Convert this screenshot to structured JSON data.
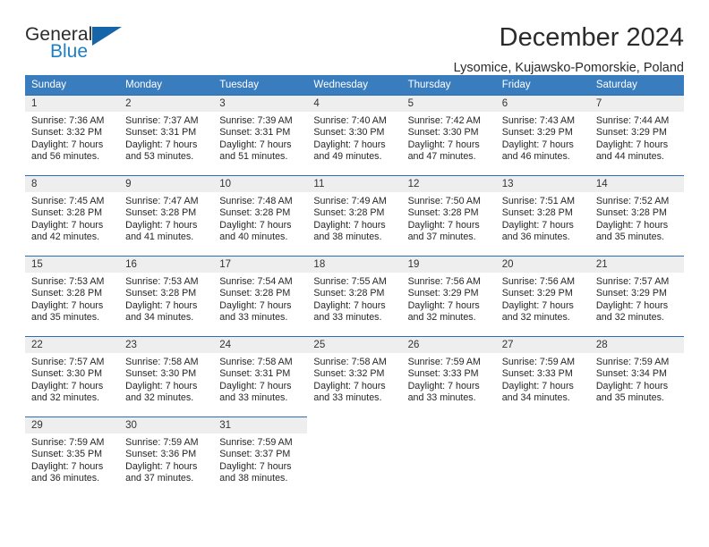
{
  "brand": {
    "name_top": "General",
    "name_bottom": "Blue",
    "mark": "triangle-logo",
    "color_top": "#2b2b2b",
    "color_bottom": "#1f7fc4",
    "color_mark": "#1565a8"
  },
  "header": {
    "title": "December 2024",
    "subtitle": "Lysomice, Kujawsko-Pomorskie, Poland"
  },
  "colors": {
    "header_bg": "#3a7dbf",
    "row_rule": "#2a6fb3",
    "daynum_bg": "#eeeeee",
    "text": "#262626"
  },
  "calendar": {
    "weekday_headers": [
      "Sunday",
      "Monday",
      "Tuesday",
      "Wednesday",
      "Thursday",
      "Friday",
      "Saturday"
    ],
    "weeks": [
      [
        {
          "day": "1",
          "sunrise": "Sunrise: 7:36 AM",
          "sunset": "Sunset: 3:32 PM",
          "daylight_line1": "Daylight: 7 hours",
          "daylight_line2": "and 56 minutes."
        },
        {
          "day": "2",
          "sunrise": "Sunrise: 7:37 AM",
          "sunset": "Sunset: 3:31 PM",
          "daylight_line1": "Daylight: 7 hours",
          "daylight_line2": "and 53 minutes."
        },
        {
          "day": "3",
          "sunrise": "Sunrise: 7:39 AM",
          "sunset": "Sunset: 3:31 PM",
          "daylight_line1": "Daylight: 7 hours",
          "daylight_line2": "and 51 minutes."
        },
        {
          "day": "4",
          "sunrise": "Sunrise: 7:40 AM",
          "sunset": "Sunset: 3:30 PM",
          "daylight_line1": "Daylight: 7 hours",
          "daylight_line2": "and 49 minutes."
        },
        {
          "day": "5",
          "sunrise": "Sunrise: 7:42 AM",
          "sunset": "Sunset: 3:30 PM",
          "daylight_line1": "Daylight: 7 hours",
          "daylight_line2": "and 47 minutes."
        },
        {
          "day": "6",
          "sunrise": "Sunrise: 7:43 AM",
          "sunset": "Sunset: 3:29 PM",
          "daylight_line1": "Daylight: 7 hours",
          "daylight_line2": "and 46 minutes."
        },
        {
          "day": "7",
          "sunrise": "Sunrise: 7:44 AM",
          "sunset": "Sunset: 3:29 PM",
          "daylight_line1": "Daylight: 7 hours",
          "daylight_line2": "and 44 minutes."
        }
      ],
      [
        {
          "day": "8",
          "sunrise": "Sunrise: 7:45 AM",
          "sunset": "Sunset: 3:28 PM",
          "daylight_line1": "Daylight: 7 hours",
          "daylight_line2": "and 42 minutes."
        },
        {
          "day": "9",
          "sunrise": "Sunrise: 7:47 AM",
          "sunset": "Sunset: 3:28 PM",
          "daylight_line1": "Daylight: 7 hours",
          "daylight_line2": "and 41 minutes."
        },
        {
          "day": "10",
          "sunrise": "Sunrise: 7:48 AM",
          "sunset": "Sunset: 3:28 PM",
          "daylight_line1": "Daylight: 7 hours",
          "daylight_line2": "and 40 minutes."
        },
        {
          "day": "11",
          "sunrise": "Sunrise: 7:49 AM",
          "sunset": "Sunset: 3:28 PM",
          "daylight_line1": "Daylight: 7 hours",
          "daylight_line2": "and 38 minutes."
        },
        {
          "day": "12",
          "sunrise": "Sunrise: 7:50 AM",
          "sunset": "Sunset: 3:28 PM",
          "daylight_line1": "Daylight: 7 hours",
          "daylight_line2": "and 37 minutes."
        },
        {
          "day": "13",
          "sunrise": "Sunrise: 7:51 AM",
          "sunset": "Sunset: 3:28 PM",
          "daylight_line1": "Daylight: 7 hours",
          "daylight_line2": "and 36 minutes."
        },
        {
          "day": "14",
          "sunrise": "Sunrise: 7:52 AM",
          "sunset": "Sunset: 3:28 PM",
          "daylight_line1": "Daylight: 7 hours",
          "daylight_line2": "and 35 minutes."
        }
      ],
      [
        {
          "day": "15",
          "sunrise": "Sunrise: 7:53 AM",
          "sunset": "Sunset: 3:28 PM",
          "daylight_line1": "Daylight: 7 hours",
          "daylight_line2": "and 35 minutes."
        },
        {
          "day": "16",
          "sunrise": "Sunrise: 7:53 AM",
          "sunset": "Sunset: 3:28 PM",
          "daylight_line1": "Daylight: 7 hours",
          "daylight_line2": "and 34 minutes."
        },
        {
          "day": "17",
          "sunrise": "Sunrise: 7:54 AM",
          "sunset": "Sunset: 3:28 PM",
          "daylight_line1": "Daylight: 7 hours",
          "daylight_line2": "and 33 minutes."
        },
        {
          "day": "18",
          "sunrise": "Sunrise: 7:55 AM",
          "sunset": "Sunset: 3:28 PM",
          "daylight_line1": "Daylight: 7 hours",
          "daylight_line2": "and 33 minutes."
        },
        {
          "day": "19",
          "sunrise": "Sunrise: 7:56 AM",
          "sunset": "Sunset: 3:29 PM",
          "daylight_line1": "Daylight: 7 hours",
          "daylight_line2": "and 32 minutes."
        },
        {
          "day": "20",
          "sunrise": "Sunrise: 7:56 AM",
          "sunset": "Sunset: 3:29 PM",
          "daylight_line1": "Daylight: 7 hours",
          "daylight_line2": "and 32 minutes."
        },
        {
          "day": "21",
          "sunrise": "Sunrise: 7:57 AM",
          "sunset": "Sunset: 3:29 PM",
          "daylight_line1": "Daylight: 7 hours",
          "daylight_line2": "and 32 minutes."
        }
      ],
      [
        {
          "day": "22",
          "sunrise": "Sunrise: 7:57 AM",
          "sunset": "Sunset: 3:30 PM",
          "daylight_line1": "Daylight: 7 hours",
          "daylight_line2": "and 32 minutes."
        },
        {
          "day": "23",
          "sunrise": "Sunrise: 7:58 AM",
          "sunset": "Sunset: 3:30 PM",
          "daylight_line1": "Daylight: 7 hours",
          "daylight_line2": "and 32 minutes."
        },
        {
          "day": "24",
          "sunrise": "Sunrise: 7:58 AM",
          "sunset": "Sunset: 3:31 PM",
          "daylight_line1": "Daylight: 7 hours",
          "daylight_line2": "and 33 minutes."
        },
        {
          "day": "25",
          "sunrise": "Sunrise: 7:58 AM",
          "sunset": "Sunset: 3:32 PM",
          "daylight_line1": "Daylight: 7 hours",
          "daylight_line2": "and 33 minutes."
        },
        {
          "day": "26",
          "sunrise": "Sunrise: 7:59 AM",
          "sunset": "Sunset: 3:33 PM",
          "daylight_line1": "Daylight: 7 hours",
          "daylight_line2": "and 33 minutes."
        },
        {
          "day": "27",
          "sunrise": "Sunrise: 7:59 AM",
          "sunset": "Sunset: 3:33 PM",
          "daylight_line1": "Daylight: 7 hours",
          "daylight_line2": "and 34 minutes."
        },
        {
          "day": "28",
          "sunrise": "Sunrise: 7:59 AM",
          "sunset": "Sunset: 3:34 PM",
          "daylight_line1": "Daylight: 7 hours",
          "daylight_line2": "and 35 minutes."
        }
      ],
      [
        {
          "day": "29",
          "sunrise": "Sunrise: 7:59 AM",
          "sunset": "Sunset: 3:35 PM",
          "daylight_line1": "Daylight: 7 hours",
          "daylight_line2": "and 36 minutes."
        },
        {
          "day": "30",
          "sunrise": "Sunrise: 7:59 AM",
          "sunset": "Sunset: 3:36 PM",
          "daylight_line1": "Daylight: 7 hours",
          "daylight_line2": "and 37 minutes."
        },
        {
          "day": "31",
          "sunrise": "Sunrise: 7:59 AM",
          "sunset": "Sunset: 3:37 PM",
          "daylight_line1": "Daylight: 7 hours",
          "daylight_line2": "and 38 minutes."
        },
        {
          "day": "",
          "sunrise": "",
          "sunset": "",
          "daylight_line1": "",
          "daylight_line2": ""
        },
        {
          "day": "",
          "sunrise": "",
          "sunset": "",
          "daylight_line1": "",
          "daylight_line2": ""
        },
        {
          "day": "",
          "sunrise": "",
          "sunset": "",
          "daylight_line1": "",
          "daylight_line2": ""
        },
        {
          "day": "",
          "sunrise": "",
          "sunset": "",
          "daylight_line1": "",
          "daylight_line2": ""
        }
      ]
    ]
  }
}
